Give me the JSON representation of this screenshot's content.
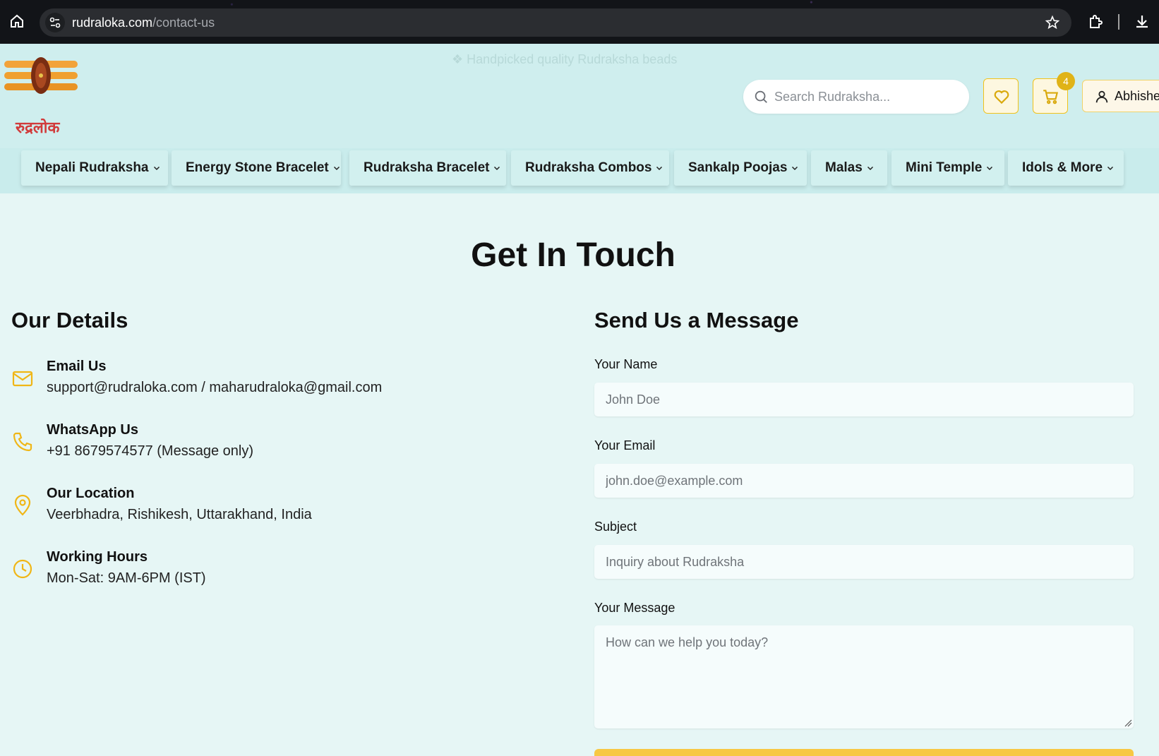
{
  "browser": {
    "url_domain": "rudraloka.com",
    "url_path": "/contact-us"
  },
  "header": {
    "promo": "Handpicked quality Rudraksha beads",
    "search_placeholder": "Search Rudraksha...",
    "cart_count": "4",
    "account_label": "Abhishe",
    "logo_text": "रुद्रलोक"
  },
  "nav": {
    "items": [
      {
        "label": "Nepali Rudraksha"
      },
      {
        "label": "Energy Stone Bracelet"
      },
      {
        "label": "Rudraksha Bracelet"
      },
      {
        "label": "Rudraksha Combos"
      },
      {
        "label": "Sankalp Poojas"
      },
      {
        "label": "Malas"
      },
      {
        "label": "Mini Temple"
      },
      {
        "label": "Idols & More"
      }
    ]
  },
  "page": {
    "title": "Get In Touch"
  },
  "details": {
    "heading": "Our Details",
    "items": [
      {
        "icon": "mail-icon",
        "label": "Email Us",
        "value": "support@rudraloka.com / maharudraloka@gmail.com"
      },
      {
        "icon": "phone-icon",
        "label": "WhatsApp Us",
        "value": "+91 8679574577 (Message only)"
      },
      {
        "icon": "map-pin-icon",
        "label": "Our Location",
        "value": "Veerbhadra, Rishikesh, Uttarakhand, India"
      },
      {
        "icon": "clock-icon",
        "label": "Working Hours",
        "value": "Mon-Sat: 9AM-6PM (IST)"
      }
    ]
  },
  "form": {
    "heading": "Send Us a Message",
    "name_label": "Your Name",
    "name_placeholder": "John Doe",
    "email_label": "Your Email",
    "email_placeholder": "john.doe@example.com",
    "subject_label": "Subject",
    "subject_placeholder": "Inquiry about Rudraksha",
    "message_label": "Your Message",
    "message_placeholder": "How can we help you today?"
  },
  "colors": {
    "accent": "#f0c21a",
    "header_bg": "#cfeeee",
    "page_bg": "#e6f6f5"
  }
}
